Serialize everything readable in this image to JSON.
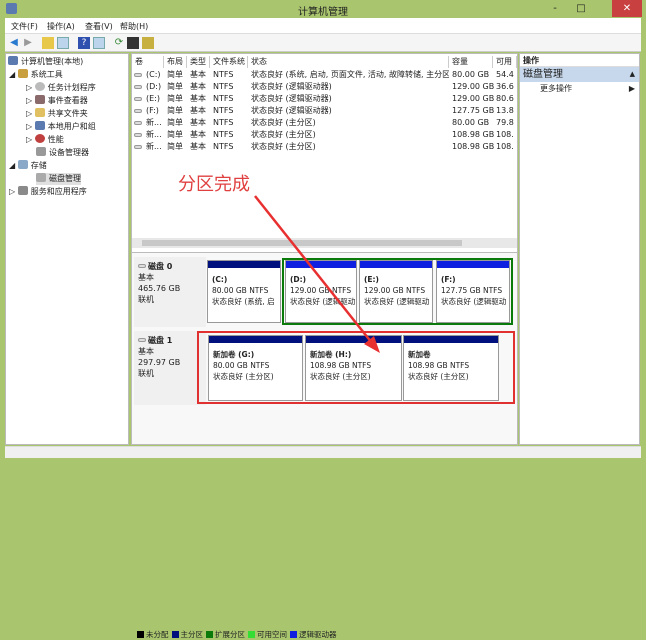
{
  "window": {
    "title": "计算机管理",
    "minimize": "-",
    "maximize": "□",
    "close": "✕"
  },
  "menu": [
    "文件(F)",
    "操作(A)",
    "查看(V)",
    "帮助(H)"
  ],
  "toolbar_icons": [
    "back-icon",
    "forward-icon",
    "up-folder-icon",
    "show-tree-icon",
    "help-icon",
    "show-pane-icon",
    "refresh-icon",
    "properties-icon",
    "export-icon"
  ],
  "tree": {
    "root": "计算机管理(本地)",
    "system_tools": "系统工具",
    "task_scheduler": "任务计划程序",
    "event_viewer": "事件查看器",
    "shared_folders": "共享文件夹",
    "local_users": "本地用户和组",
    "performance": "性能",
    "device_manager": "设备管理器",
    "storage": "存储",
    "disk_management": "磁盘管理",
    "services": "服务和应用程序"
  },
  "table": {
    "headers": [
      "卷",
      "布局",
      "类型",
      "文件系统",
      "状态",
      "容量",
      "可用"
    ],
    "rows": [
      [
        "(C:)",
        "简单",
        "基本",
        "NTFS",
        "状态良好 (系统, 启动, 页面文件, 活动, 故障转储, 主分区)",
        "80.00 GB",
        "54.4"
      ],
      [
        "(D:)",
        "简单",
        "基本",
        "NTFS",
        "状态良好 (逻辑驱动器)",
        "129.00 GB",
        "36.6"
      ],
      [
        "(E:)",
        "简单",
        "基本",
        "NTFS",
        "状态良好 (逻辑驱动器)",
        "129.00 GB",
        "80.6"
      ],
      [
        "(F:)",
        "简单",
        "基本",
        "NTFS",
        "状态良好 (逻辑驱动器)",
        "127.75 GB",
        "13.8"
      ],
      [
        "新...",
        "简单",
        "基本",
        "NTFS",
        "状态良好 (主分区)",
        "80.00 GB",
        "79.8"
      ],
      [
        "新...",
        "简单",
        "基本",
        "NTFS",
        "状态良好 (主分区)",
        "108.98 GB",
        "108."
      ],
      [
        "新...",
        "简单",
        "基本",
        "NTFS",
        "状态良好 (主分区)",
        "108.98 GB",
        "108."
      ]
    ]
  },
  "annotation": "分区完成",
  "disks": [
    {
      "name": "磁盘 0",
      "type": "基本",
      "size": "465.76 GB",
      "state": "联机",
      "parts": [
        {
          "title": "(C:)",
          "size": "80.00 GB NTFS",
          "status": "状态良好 (系统, 启"
        },
        {
          "title": "(D:)",
          "size": "129.00 GB NTFS",
          "status": "状态良好 (逻辑驱动"
        },
        {
          "title": "(E:)",
          "size": "129.00 GB NTFS",
          "status": "状态良好 (逻辑驱动"
        },
        {
          "title": "(F:)",
          "size": "127.75 GB NTFS",
          "status": "状态良好 (逻辑驱动"
        }
      ]
    },
    {
      "name": "磁盘 1",
      "type": "基本",
      "size": "297.97 GB",
      "state": "联机",
      "parts": [
        {
          "title": "新加卷  (G:)",
          "size": "80.00 GB NTFS",
          "status": "状态良好 (主分区)"
        },
        {
          "title": "新加卷  (H:)",
          "size": "108.98 GB NTFS",
          "status": "状态良好 (主分区)"
        },
        {
          "title": "新加卷",
          "size": "108.98 GB NTFS",
          "status": "状态良好 (主分区)"
        }
      ]
    }
  ],
  "legend": [
    {
      "label": "未分配",
      "color": "#000000"
    },
    {
      "label": "主分区",
      "color": "#00107c"
    },
    {
      "label": "扩展分区",
      "color": "#0a7a0a"
    },
    {
      "label": "可用空间",
      "color": "#33dd33"
    },
    {
      "label": "逻辑驱动器",
      "color": "#1020e0"
    }
  ],
  "actions": {
    "header": "操作",
    "section": "磁盘管理",
    "more": "更多操作"
  },
  "colors": {
    "primary": "#00107c",
    "logical": "#1020e0",
    "extended": "#0a7a0a",
    "highlight": "#e03030"
  }
}
